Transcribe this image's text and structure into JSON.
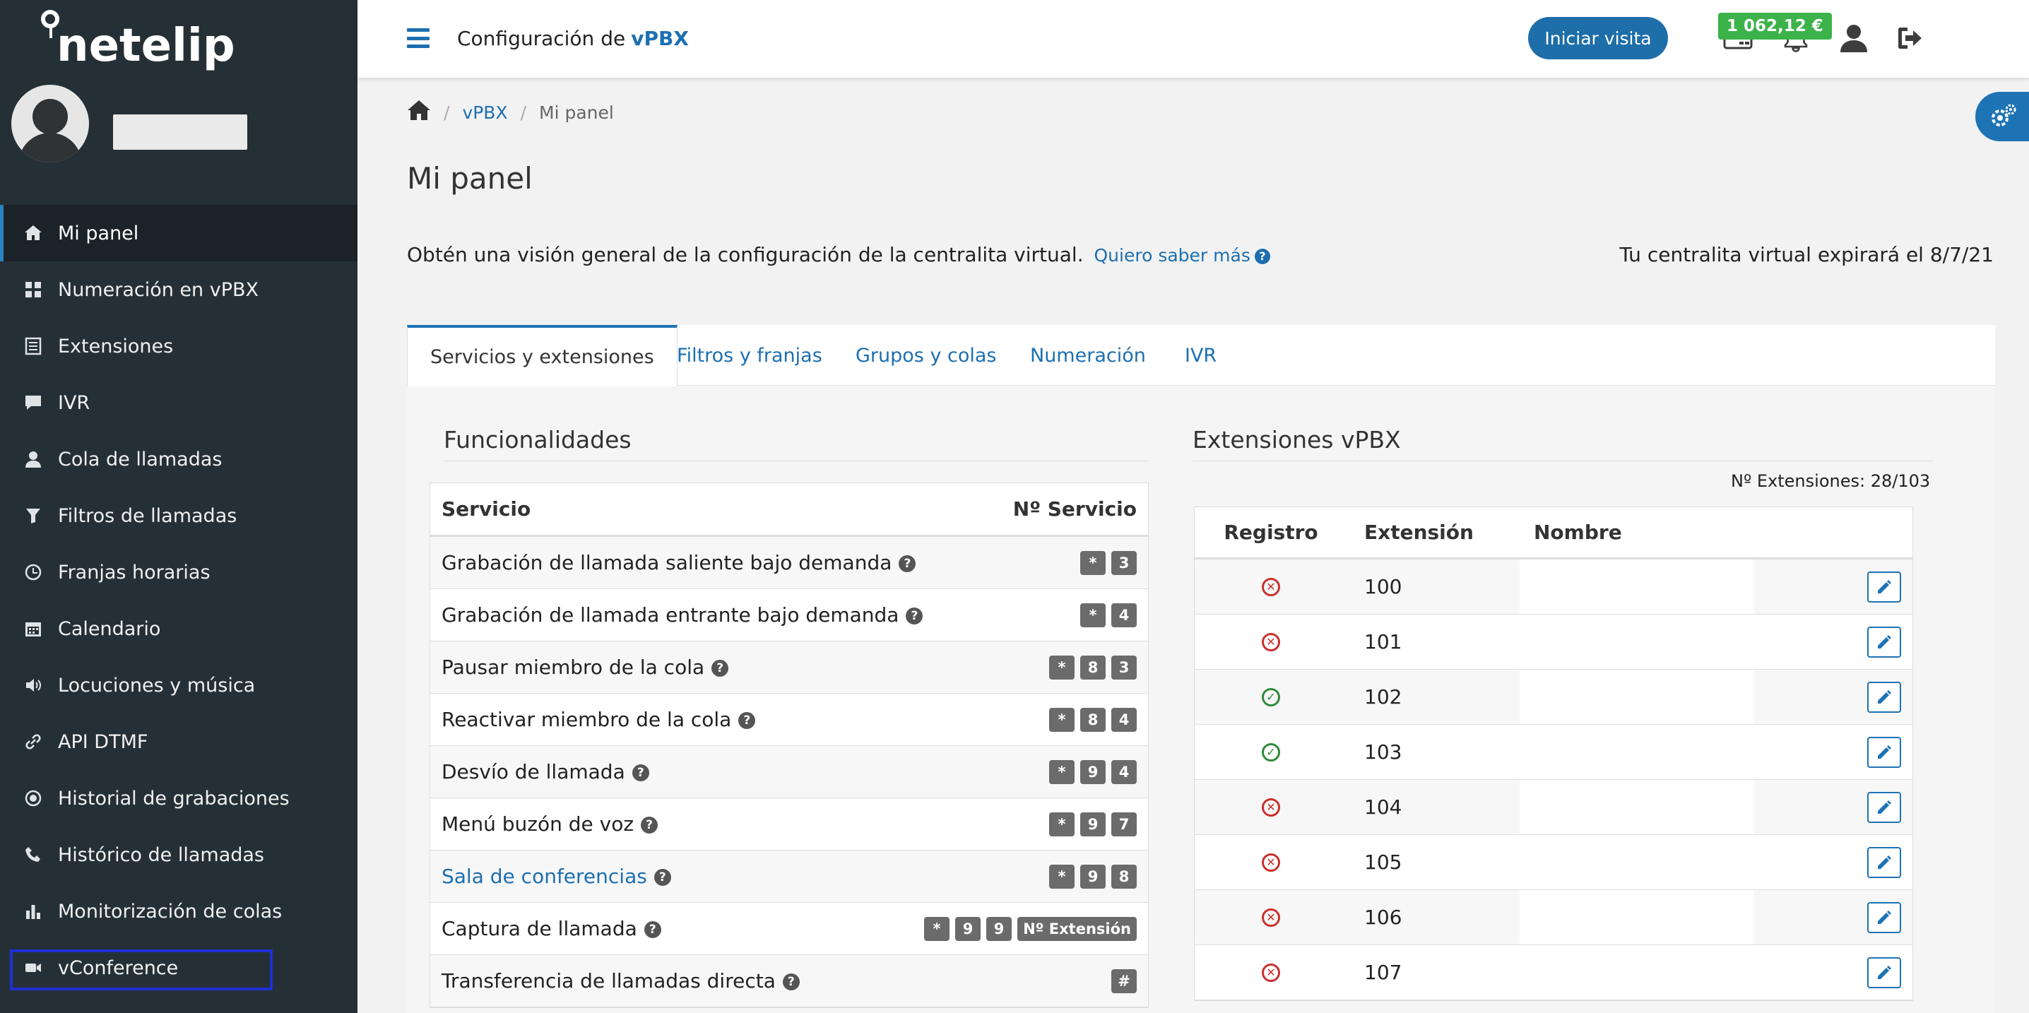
{
  "sidebar": {
    "logo": "netelip",
    "items": [
      {
        "label": "Mi panel",
        "icon": "home-icon",
        "active": true
      },
      {
        "label": "Numeración en vPBX",
        "icon": "grid-icon"
      },
      {
        "label": "Extensiones",
        "icon": "list-icon"
      },
      {
        "label": "IVR",
        "icon": "comment-icon"
      },
      {
        "label": "Cola de llamadas",
        "icon": "user-icon"
      },
      {
        "label": "Filtros de llamadas",
        "icon": "filter-icon"
      },
      {
        "label": "Franjas horarias",
        "icon": "clock-icon"
      },
      {
        "label": "Calendario",
        "icon": "calendar-icon"
      },
      {
        "label": "Locuciones y música",
        "icon": "speaker-icon"
      },
      {
        "label": "API DTMF",
        "icon": "link-icon"
      },
      {
        "label": "Historial de grabaciones",
        "icon": "record-icon"
      },
      {
        "label": "Histórico de llamadas",
        "icon": "phone-icon"
      },
      {
        "label": "Monitorización de colas",
        "icon": "bar-chart-icon"
      },
      {
        "label": "vConference",
        "icon": "video-icon"
      }
    ]
  },
  "topbar": {
    "title_prefix": "Configuración de",
    "title_bold": "vPBX",
    "visit_button": "Iniciar visita",
    "balance": "1 062,12 €",
    "icons": [
      "credit-card-icon",
      "bell-icon",
      "user-icon",
      "logout-icon"
    ]
  },
  "breadcrumb": {
    "items": [
      "vPBX",
      "Mi panel"
    ]
  },
  "page": {
    "title": "Mi panel",
    "intro": "Obtén una visión general de la configuración de la centralita virtual.",
    "more_link": "Quiero saber más",
    "expire": "Tu centralita virtual expirará el 8/7/21"
  },
  "tabs": [
    "Servicios y extensiones",
    "Filtros y franjas",
    "Grupos y colas",
    "Numeración",
    "IVR"
  ],
  "funcionalidades": {
    "title": "Funcionalidades",
    "col_service": "Servicio",
    "col_number": "Nº Servicio",
    "rows": [
      {
        "name": "Grabación de llamada saliente bajo demanda",
        "keys": [
          "*",
          "3"
        ],
        "link": false
      },
      {
        "name": "Grabación de llamada entrante bajo demanda",
        "keys": [
          "*",
          "4"
        ],
        "link": false
      },
      {
        "name": "Pausar miembro de la cola",
        "keys": [
          "*",
          "8",
          "3"
        ],
        "link": false
      },
      {
        "name": "Reactivar miembro de la cola",
        "keys": [
          "*",
          "8",
          "4"
        ],
        "link": false
      },
      {
        "name": "Desvío de llamada",
        "keys": [
          "*",
          "9",
          "4"
        ],
        "link": false
      },
      {
        "name": "Menú buzón de voz",
        "keys": [
          "*",
          "9",
          "7"
        ],
        "link": false
      },
      {
        "name": "Sala de conferencias",
        "keys": [
          "*",
          "9",
          "8"
        ],
        "link": true
      },
      {
        "name": "Captura de llamada",
        "keys": [
          "*",
          "9",
          "9",
          "Nº Extensión"
        ],
        "link": false
      },
      {
        "name": "Transferencia de llamadas directa",
        "keys": [
          "#"
        ],
        "link": false
      }
    ]
  },
  "extensiones": {
    "title": "Extensiones vPBX",
    "count": "Nº Extensiones: 28/103",
    "col_registro": "Registro",
    "col_extension": "Extensión",
    "col_nombre": "Nombre",
    "rows": [
      {
        "ext": "100",
        "registered": false
      },
      {
        "ext": "101",
        "registered": false
      },
      {
        "ext": "102",
        "registered": true
      },
      {
        "ext": "103",
        "registered": true
      },
      {
        "ext": "104",
        "registered": false
      },
      {
        "ext": "105",
        "registered": false
      },
      {
        "ext": "106",
        "registered": false
      },
      {
        "ext": "107",
        "registered": false
      }
    ]
  }
}
